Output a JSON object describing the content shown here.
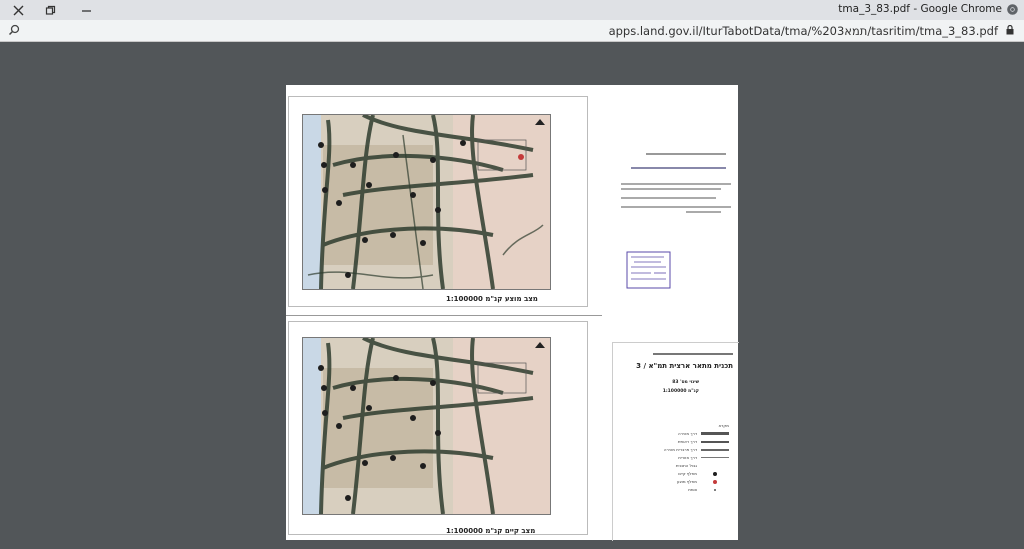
{
  "window": {
    "title": "tma_3_83.pdf - Google Chrome",
    "close_icon": "close-icon",
    "restore_icon": "restore-icon",
    "minimize_icon": "minimize-icon"
  },
  "address": {
    "url": "apps.land.gov.il/IturTabotData/tma/%203תמא/tasritim/tma_3_83.pdf"
  },
  "document": {
    "top_map_caption": "מצב מוצע קנ\"מ 1:100000",
    "bottom_map_caption": "מצב קיים קנ\"מ 1:100000",
    "plan_title": "תכנית מתאר ארצית תמ\"א / 3",
    "plan_subtitle": "שינוי מס' 83",
    "plan_scale": "קנ\"מ 1:100000",
    "legend_title": "מקרא",
    "legend_items": [
      "דרך מהירה",
      "דרך ראשית",
      "דרך פרברית מהירה",
      "דרך אזורית",
      "גבול התכנית",
      "מחלף קיים",
      "מחלף מוצע",
      "צומת"
    ]
  },
  "colors": {
    "titlebar": "#dfe1e5",
    "addrbar": "#f1f3f4",
    "viewer_bg": "#525659",
    "road": "#3a4a3a",
    "interchange_existing": "#1e1e1e",
    "interchange_proposed": "#c43a3a",
    "stamp": "#5a4aa8"
  }
}
